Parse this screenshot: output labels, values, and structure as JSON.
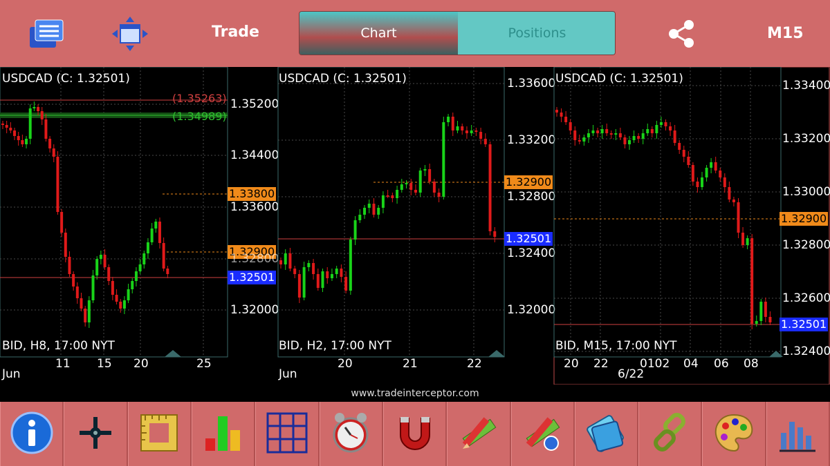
{
  "header": {
    "title": "Trade",
    "tabs": [
      {
        "label": "Chart",
        "active": true
      },
      {
        "label": "Positions",
        "active": false
      }
    ],
    "timeframe": "M15"
  },
  "charts": [
    {
      "symbol_label": "USDCAD (C: 1.32501)",
      "footer_label": "BID, H8, 17:00 NYT",
      "y_ticks": [
        "1.35200",
        "1.34400",
        "1.33600",
        "1.32800",
        "1.32000"
      ],
      "x_ticks": [
        "11",
        "15",
        "20",
        "25"
      ],
      "month_label": "Jun",
      "level_tags": [
        {
          "text": "(1.35263)",
          "color": "#d04040"
        },
        {
          "text": "(1.34989)",
          "color": "#2fbf2f"
        },
        {
          "text": "1.33800",
          "type": "order"
        },
        {
          "text": "1.32900",
          "type": "order"
        },
        {
          "text": "1.32501",
          "type": "bid"
        }
      ]
    },
    {
      "symbol_label": "USDCAD (C: 1.32501)",
      "footer_label": "BID, H2, 17:00 NYT",
      "y_ticks": [
        "1.33600",
        "1.33200",
        "1.32800",
        "1.32400",
        "1.32000"
      ],
      "x_ticks": [
        "20",
        "21",
        "22"
      ],
      "month_label": "Jun",
      "level_tags": [
        {
          "text": "1.32900",
          "type": "order"
        },
        {
          "text": "1.32501",
          "type": "bid"
        }
      ]
    },
    {
      "symbol_label": "USDCAD (C: 1.32501)",
      "footer_label": "BID, M15, 17:00 NYT",
      "y_ticks": [
        "1.33400",
        "1.33200",
        "1.33000",
        "1.32800",
        "1.32600",
        "1.32400"
      ],
      "x_ticks": [
        "20",
        "22",
        "0102",
        "04",
        "06",
        "08"
      ],
      "date_label": "6/22",
      "level_tags": [
        {
          "text": "1.32900",
          "type": "order"
        },
        {
          "text": "1.32501",
          "type": "bid"
        }
      ]
    }
  ],
  "footer": {
    "website": "www.tradeinterceptor.com"
  },
  "toolbar": {
    "icons": [
      "info-icon",
      "crosshair-icon",
      "ruler-icon",
      "indicators-icon",
      "grid-icon",
      "alarm-icon",
      "magnet-icon",
      "pencil-ruler-icon",
      "pencil-ruler-settings-icon",
      "folder-icon",
      "link-icon",
      "palette-icon",
      "chart-tools-icon"
    ]
  },
  "colors": {
    "bull": "#19d319",
    "bear": "#e01a1a",
    "bar": "#d06a6a",
    "order_line": "#f08a1a",
    "bid_line": "#1a2cff"
  }
}
